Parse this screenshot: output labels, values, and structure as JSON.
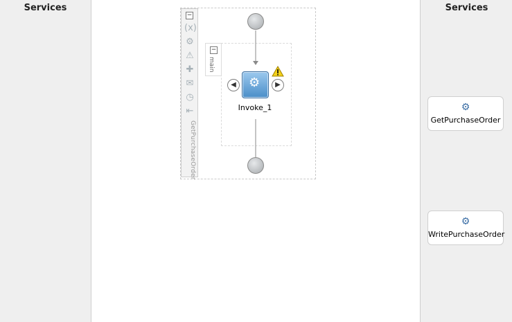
{
  "left_lane": {
    "title": "Services"
  },
  "right_lane": {
    "title": "Services",
    "services": [
      {
        "label": "GetPurchaseOrder",
        "icon": "service-adapter-icon"
      },
      {
        "label": "WritePurchaseOrder",
        "icon": "service-file-icon"
      }
    ]
  },
  "process": {
    "scope_name": "GetPurchaseOrder",
    "sequence_name": "main",
    "invoke_label": "Invoke_1",
    "warning_icon": "warning-icon",
    "toolbar_icons": [
      "variables-icon",
      "correlation-icon",
      "fault-handler-icon",
      "event-handler-icon",
      "message-icon",
      "timer-icon",
      "compensation-icon"
    ]
  },
  "colors": {
    "accent": "#4a8ec8",
    "lane_bg": "#efefef"
  }
}
